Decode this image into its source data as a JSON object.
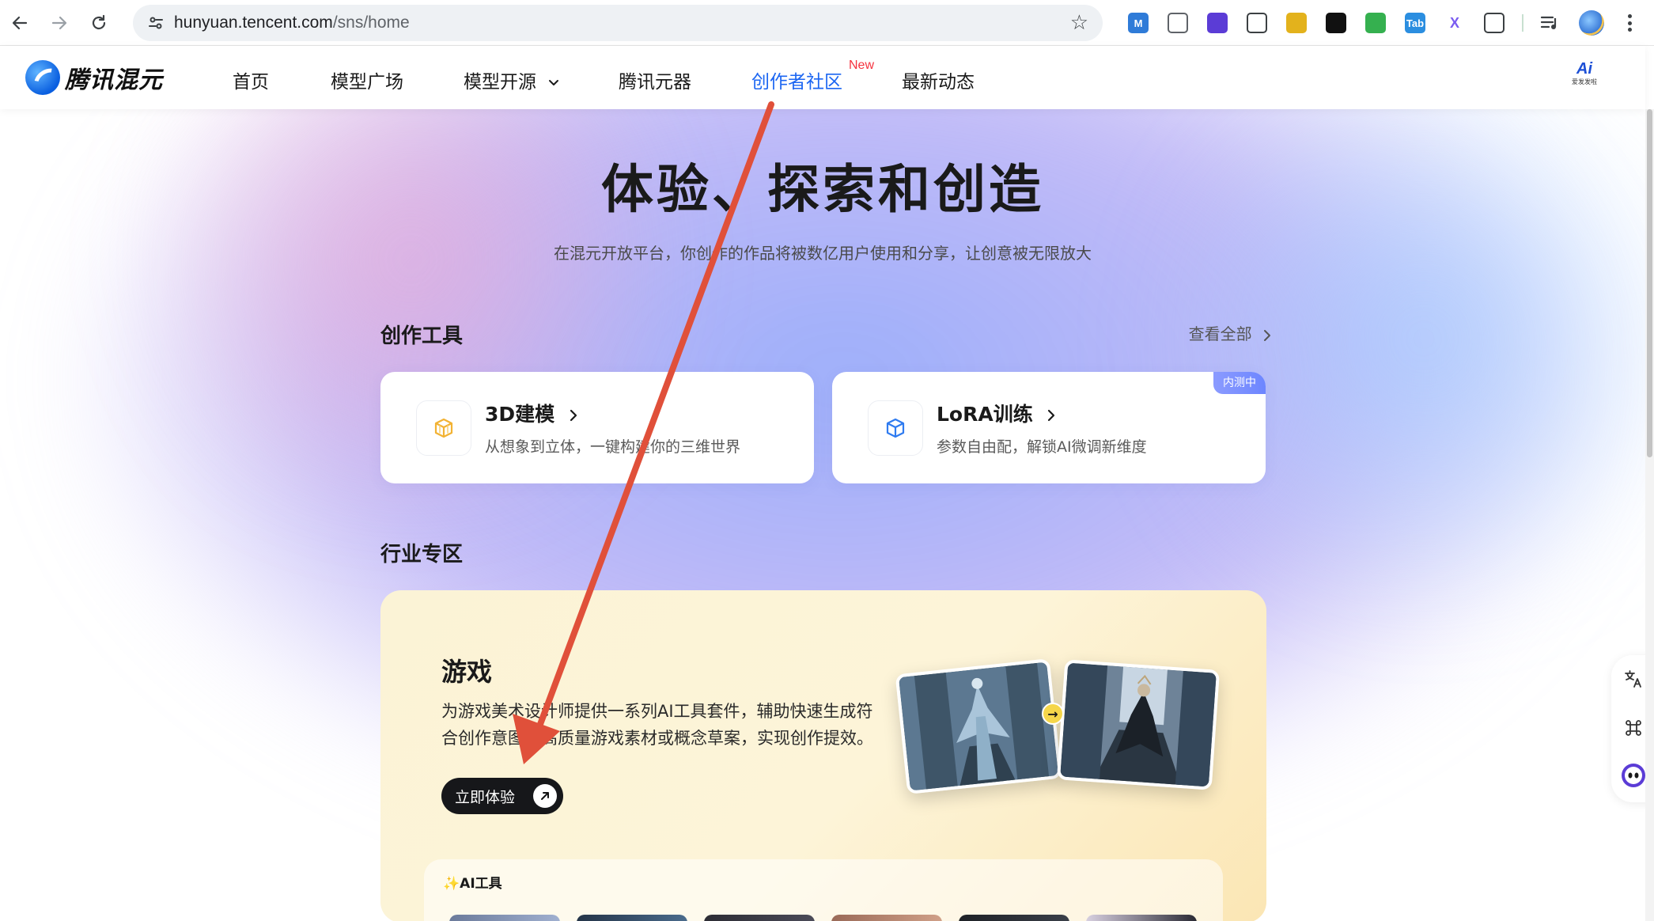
{
  "browser": {
    "url_host": "hunyuan.tencent.com",
    "url_path": "/sns/home",
    "extensions": [
      {
        "icon": "m-extension-icon",
        "label": "M",
        "color": "#2f7bd8"
      },
      {
        "icon": "copy-extension-icon",
        "label": "",
        "color": "#5f6368"
      },
      {
        "icon": "bot-extension-icon",
        "label": "",
        "color": "#5b3cd6"
      },
      {
        "icon": "qr-extension-icon",
        "label": "",
        "color": "#3c4043"
      },
      {
        "icon": "pony-extension-icon",
        "label": "",
        "color": "#e3b21c"
      },
      {
        "icon": "mask-extension-icon",
        "label": "",
        "color": "#111111"
      },
      {
        "icon": "shield-extension-icon",
        "label": "",
        "color": "#35b04f"
      },
      {
        "icon": "tab-extension-icon",
        "label": "Tab",
        "color": "#2b8ee0"
      },
      {
        "icon": "x-extension-icon",
        "label": "X",
        "color": "#7a5cf0"
      },
      {
        "icon": "puzzle-extension-icon",
        "label": "",
        "color": "#3c4043"
      }
    ]
  },
  "header": {
    "brand": "腾讯混元",
    "nav": [
      {
        "label": "首页",
        "active": false
      },
      {
        "label": "模型广场",
        "active": false
      },
      {
        "label": "模型开源",
        "active": false,
        "dropdown": true
      },
      {
        "label": "腾讯元器",
        "active": false
      },
      {
        "label": "创作者社区",
        "active": true,
        "badge": "New"
      },
      {
        "label": "最新动态",
        "active": false
      }
    ],
    "right_logo": "Ai",
    "right_logo_sub": "爱发发啦"
  },
  "hero": {
    "title": "体验、探索和创造",
    "subtitle": "在混元开放平台，你创作的作品将被数亿用户使用和分享，让创意被无限放大"
  },
  "tools_section": {
    "title": "创作工具",
    "view_all": "查看全部",
    "cards": [
      {
        "name": "3D建模",
        "desc": "从想象到立体，一键构建你的三维世界",
        "icon": "cube-wireframe-icon",
        "badge": ""
      },
      {
        "name": "LoRA训练",
        "desc": "参数自由配，解锁AI微调新维度",
        "icon": "cube-icon",
        "badge": "内测中"
      }
    ]
  },
  "industry_section": {
    "title": "行业专区",
    "game": {
      "title": "游戏",
      "desc": "为游戏美术设计师提供一系列AI工具套件，辅助快速生成符合创作意图的高质量游戏素材或概念草案，实现创作提效。",
      "button": "立即体验",
      "ai_tools_label": "✨AI工具"
    }
  },
  "colors": {
    "accent": "#1c66f2",
    "new_badge": "#f5333f",
    "annotation": "#e0503a"
  }
}
